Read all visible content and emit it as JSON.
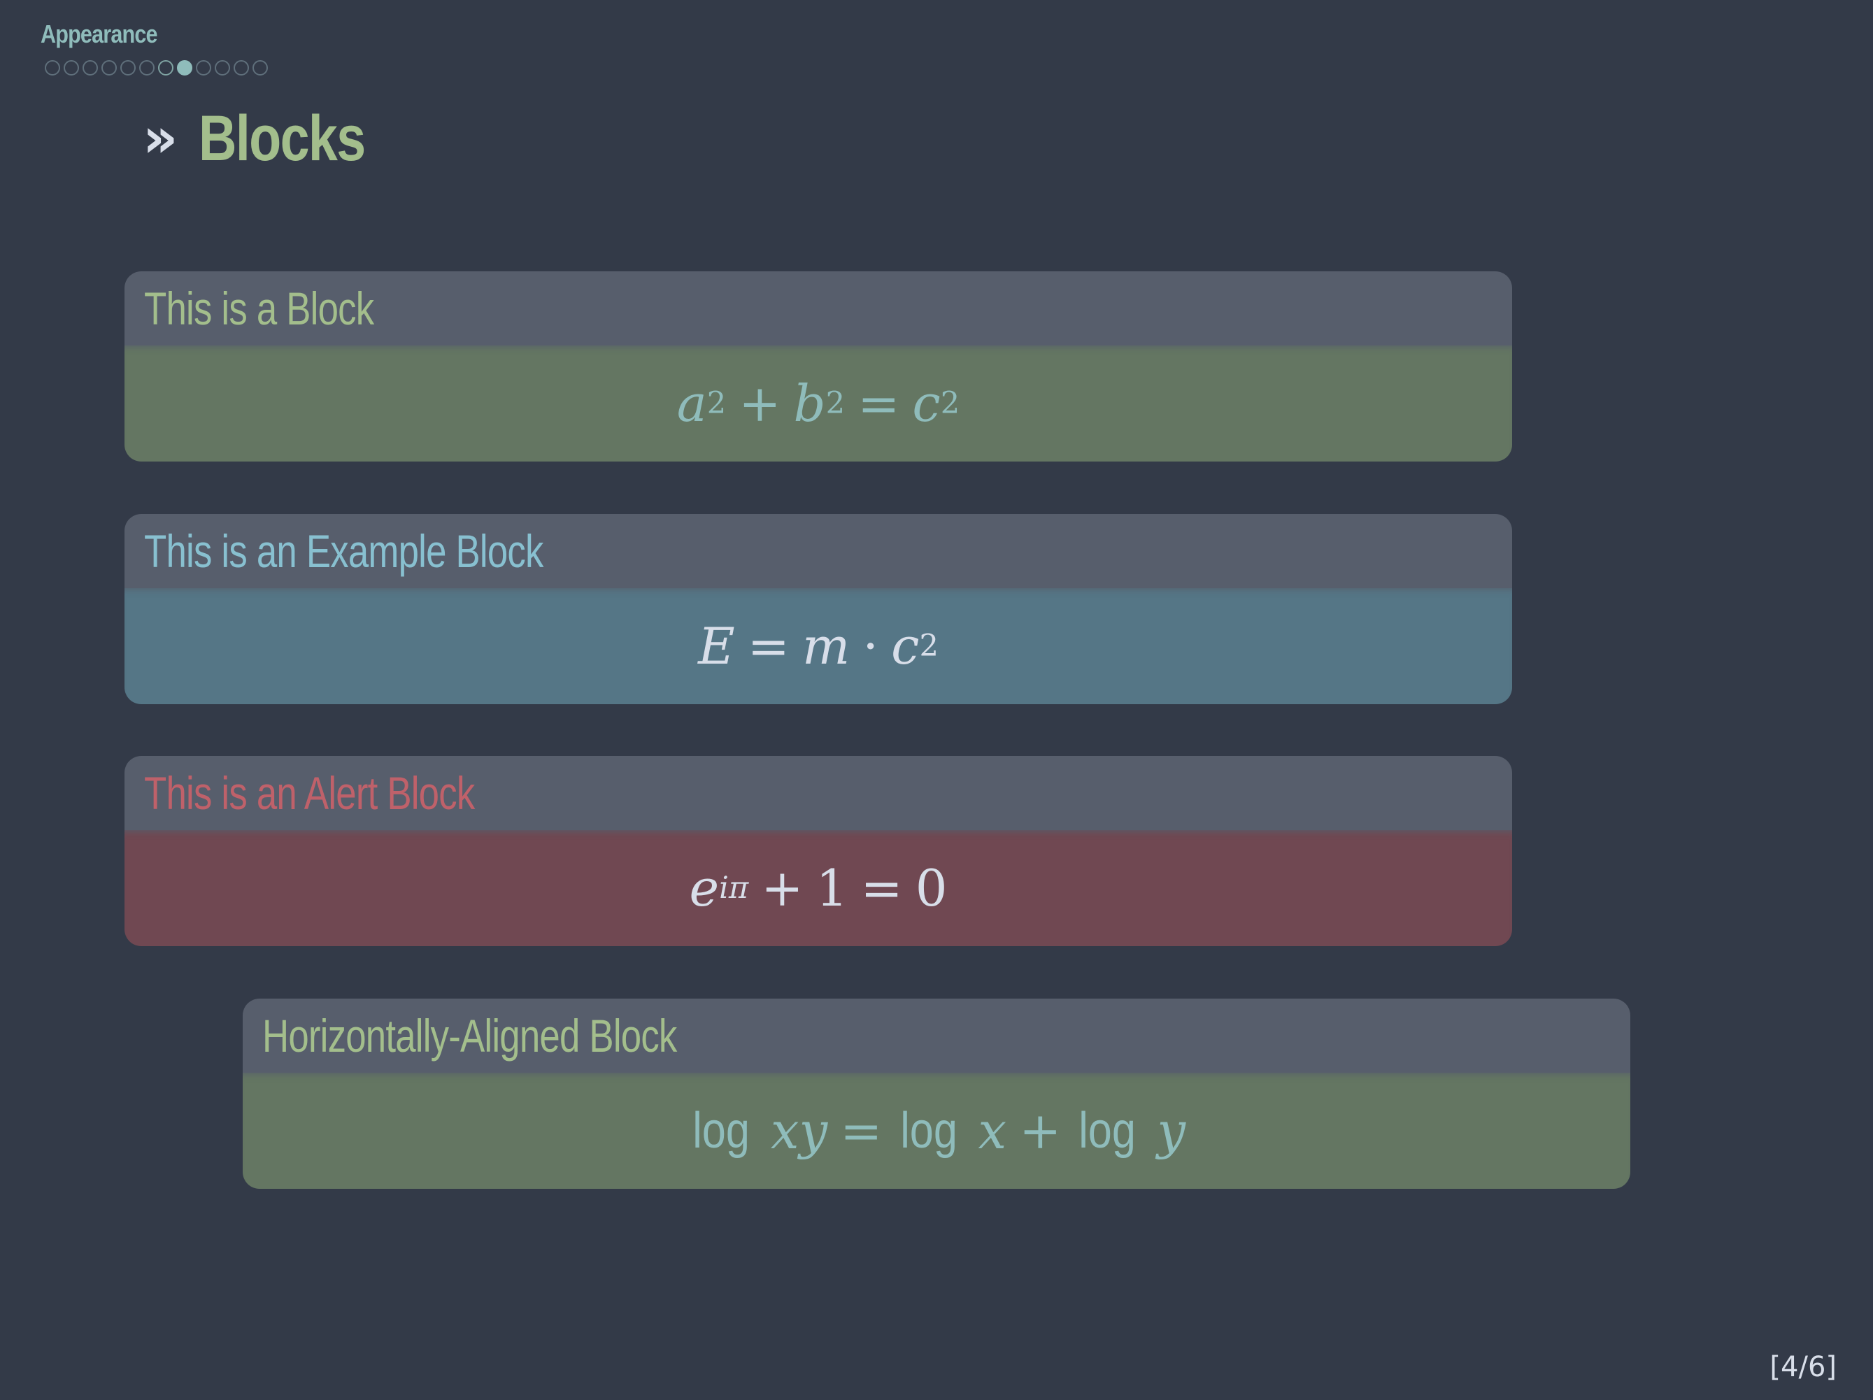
{
  "header": {
    "section": "Appearance",
    "nav_dots": {
      "total": 12,
      "visited": 7,
      "current": 8
    }
  },
  "frame": {
    "marker": "»",
    "title": "Blocks"
  },
  "blocks": [
    {
      "kind": "block",
      "title": "This is a Block",
      "formula": {
        "a": "a",
        "plus": "+",
        "b": "b",
        "eq": "=",
        "c": "c",
        "exp": "2"
      }
    },
    {
      "kind": "example",
      "title": "This is an Example Block",
      "formula": {
        "E": "E",
        "eq": "=",
        "m": "m",
        "dot": "·",
        "c": "c",
        "exp": "2"
      }
    },
    {
      "kind": "alert",
      "title": "This is an Alert Block",
      "formula": {
        "e": "e",
        "exp": "iπ",
        "plus": "+",
        "one": "1",
        "eq": "=",
        "zero": "0"
      }
    },
    {
      "kind": "block",
      "title": "Horizontally-Aligned Block",
      "formula": {
        "log": "log",
        "xy": "xy",
        "eq": "=",
        "x": "x",
        "plus": "+",
        "y": "y"
      }
    }
  ],
  "footer": {
    "page": "[4/6]"
  },
  "colors": {
    "background": "#333a48",
    "block_title_bar": "#575e6c",
    "standard_body": "#647662",
    "example_body": "#557686",
    "alert_body": "#704852",
    "accent_green": "#a3be8c",
    "accent_blue": "#88c0d0",
    "accent_red": "#bf616a",
    "accent_teal": "#8fbcbb"
  }
}
